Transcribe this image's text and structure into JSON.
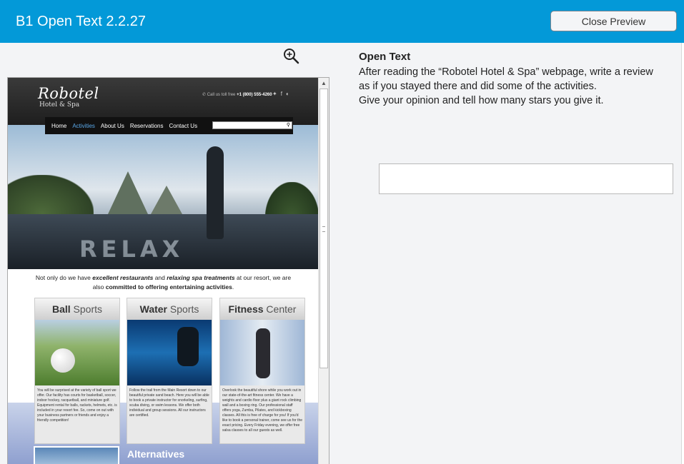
{
  "header": {
    "title": "B1 Open Text 2.2.27",
    "close_label": "Close Preview"
  },
  "colors": {
    "accent": "#0399d8",
    "nav_active": "#5aa8e8"
  },
  "preview": {
    "logo": "Robotel",
    "logo_sub": "Hotel & Spa",
    "contact_label": "Call us toll free",
    "contact_phone": "+1 (800) 555-4260",
    "social_icons": [
      "twitter-icon",
      "facebook-icon",
      "rss-icon"
    ],
    "nav": [
      "Home",
      "Activities",
      "About Us",
      "Reservations",
      "Contact Us"
    ],
    "hero_word": "RELAX",
    "intro_parts": [
      "Not only do we have ",
      "excellent restaurants",
      " and ",
      "relaxing spa treatments",
      " at our resort, we are also ",
      "committed to offering entertaining activities",
      "."
    ],
    "cards": [
      {
        "title_bold": "Ball",
        "title_rest": " Sports",
        "text": "You will be surprised at the variety of ball sport we offer. Our facility has courts for basketball, soccer, indoor hockey, racquetball, and miniature golf. Equipment rental for balls, rackets, helmets, etc. is included in your resort fee. So, come on out with your business partners or friends and enjoy a friendly competition!"
      },
      {
        "title_bold": "Water",
        "title_rest": " Sports",
        "text": "Follow the trail from the Main Resort down to our beautiful private sand beach. Here you will be able to book a private instructor for snorkeling, surfing, scuba diving, or swim lessons. We offer both individual and group sessions. All our instructors are certified."
      },
      {
        "title_bold": "Fitness",
        "title_rest": " Center",
        "text": "Overlook the beautiful shore while you work out in our state-of-the-art fitness center. We have a weights and cardio floor plus a giant rock climbing wall and a boxing ring. Our professional staff offers yoga, Zumba, Pilates, and kickboxing classes. All this is free of charge for you! If you'd like to book a personal trainer, come see us for the exact pricing. Every Friday evening, we offer free salsa classes to all our guests as well."
      }
    ],
    "alternatives_title": "Alternatives"
  },
  "task": {
    "title": "Open Text",
    "lines": [
      "After reading the “Robotel Hotel & Spa” webpage, write a review",
      "as if you stayed there and did some of the activities.",
      "Give your opinion and tell how many stars you give it."
    ],
    "answer_value": ""
  }
}
